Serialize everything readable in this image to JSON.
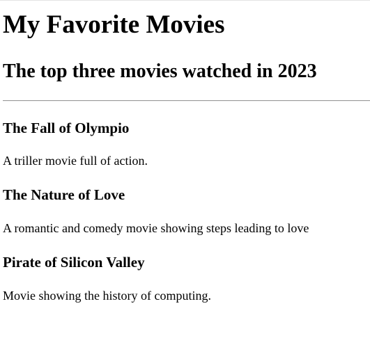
{
  "page": {
    "title": "My Favorite Movies",
    "subtitle": "The top three movies watched in 2023"
  },
  "movies": [
    {
      "title": "The Fall of Olympio",
      "description": "A triller movie full of action."
    },
    {
      "title": "The Nature of Love",
      "description": "A romantic and comedy movie showing steps leading to love"
    },
    {
      "title": "Pirate of Silicon Valley",
      "description": "Movie showing the history of computing."
    }
  ]
}
